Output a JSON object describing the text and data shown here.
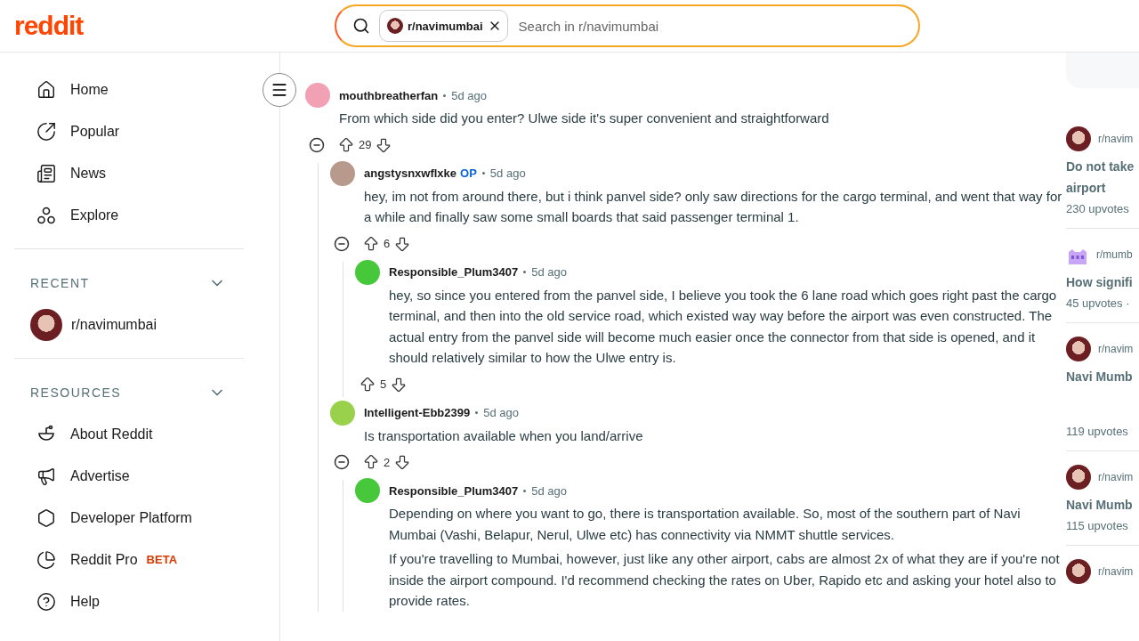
{
  "header": {
    "logo": "reddit",
    "search": {
      "chip": "r/navimumbai",
      "placeholder": "Search in r/navimumbai"
    }
  },
  "sidebar": {
    "nav": [
      {
        "label": "Home"
      },
      {
        "label": "Popular"
      },
      {
        "label": "News"
      },
      {
        "label": "Explore"
      }
    ],
    "sections": [
      {
        "title": "RECENT",
        "expanded": true,
        "items": [
          {
            "label": "r/navimumbai"
          }
        ]
      },
      {
        "title": "RESOURCES",
        "expanded": true,
        "items": [
          {
            "label": "About Reddit"
          },
          {
            "label": "Advertise"
          },
          {
            "label": "Developer Platform"
          },
          {
            "label": "Reddit Pro",
            "badge": "BETA"
          },
          {
            "label": "Help"
          }
        ]
      }
    ]
  },
  "comments": [
    {
      "author": "mouthbreatherfan",
      "op": false,
      "time": "5d ago",
      "color": "#f2a0b4",
      "body": [
        "From which side did you enter? Ulwe side it's super convenient and straightforward"
      ],
      "votes": "29",
      "children": [
        {
          "author": "angstysnxwflxke",
          "op": true,
          "op_label": "OP",
          "time": "5d ago",
          "color": "#b89a8c",
          "body": [
            "hey, im not from around there, but i think panvel side? only saw directions for the cargo terminal, and went that way for a while and finally saw some small boards that said passenger terminal 1."
          ],
          "votes": "6",
          "children": [
            {
              "author": "Responsible_Plum3407",
              "op": false,
              "time": "5d ago",
              "color": "#46c83a",
              "body": [
                "hey, so since you entered from the panvel side, I believe you took the 6 lane road which goes right past the cargo terminal, and then into the old service road, which existed way way before the airport was even constructed. The actual entry from the panvel side will become much easier once the connector from that side is opened, and it should relatively similar to how the Ulwe entry is."
              ],
              "votes": "5"
            }
          ]
        },
        {
          "author": "Intelligent-Ebb2399",
          "op": false,
          "time": "5d ago",
          "color": "#9ad14a",
          "body": [
            "Is transportation available when you land/arrive"
          ],
          "votes": "2",
          "children": [
            {
              "author": "Responsible_Plum3407",
              "op": false,
              "time": "5d ago",
              "color": "#46c83a",
              "body": [
                "Depending on where you want to go, there is transportation available. So, most of the southern part of Navi Mumbai (Vashi, Belapur, Nerul, Ulwe etc) has connectivity via NMMT shuttle services.",
                "If you're travelling to Mumbai, however, just like any other airport, cabs are almost 2x of what they are if you're not inside the airport compound. I'd recommend checking the rates on Uber, Rapido etc and asking your hotel also to provide rates."
              ]
            }
          ]
        }
      ]
    }
  ],
  "related_posts": [
    {
      "community": "r/navim",
      "kind": "photo",
      "title": "Do not take airport",
      "upvotes": "230 upvotes"
    },
    {
      "community": "r/mumb",
      "kind": "building",
      "title": "How signifi",
      "upvotes": "45 upvotes ·"
    },
    {
      "community": "r/navim",
      "kind": "photo",
      "title": "Navi Mumb",
      "upvotes": "119 upvotes"
    },
    {
      "community": "r/navim",
      "kind": "photo",
      "title": "Navi Mumb",
      "upvotes": "115 upvotes"
    },
    {
      "community": "r/navim",
      "kind": "photo"
    }
  ]
}
